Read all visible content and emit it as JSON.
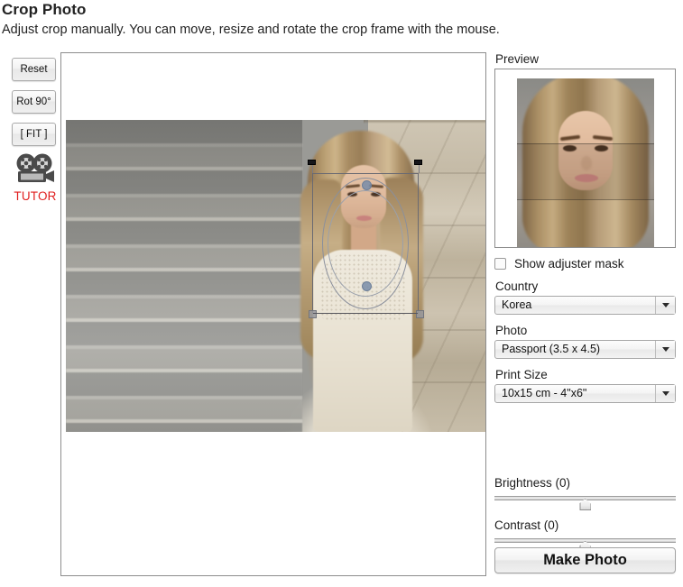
{
  "header": {
    "title": "Crop Photo",
    "subtitle": "Adjust crop manually. You can move, resize and rotate the crop frame with the mouse."
  },
  "toolbar": {
    "reset_label": "Reset",
    "rotate_label": "Rot 90°",
    "fit_label": "[ FIT ]",
    "tutor_label": "TUTOR",
    "tutor_icon": "movie-camera-icon",
    "tutor_color": "#e02020"
  },
  "editor": {
    "crop_frame_name": "crop-frame",
    "handles": [
      "top-left",
      "top-right",
      "bottom-left",
      "bottom-right",
      "top-center-rotate",
      "bottom-center-rotate"
    ]
  },
  "preview": {
    "label": "Preview",
    "mask_checkbox_label": "Show adjuster mask",
    "mask_checked": false
  },
  "fields": {
    "country": {
      "label": "Country",
      "value": "Korea"
    },
    "photo": {
      "label": "Photo",
      "value": "Passport (3.5 x 4.5)"
    },
    "print_size": {
      "label": "Print Size",
      "value": "10x15 cm - 4\"x6\""
    }
  },
  "adjust": {
    "brightness_label": "Brightness (0)",
    "brightness_value": 0,
    "contrast_label": "Contrast (0)",
    "contrast_value": 0
  },
  "actions": {
    "make_photo_label": "Make Photo"
  }
}
